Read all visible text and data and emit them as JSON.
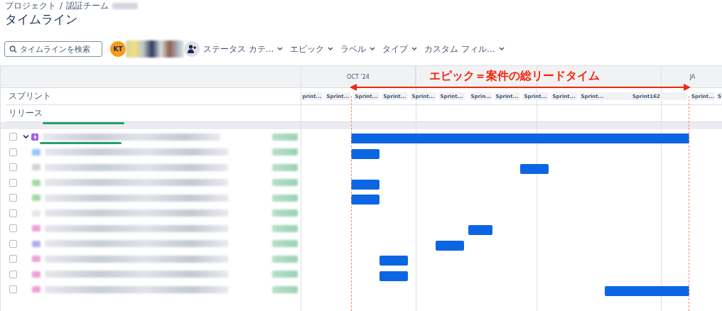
{
  "breadcrumb": {
    "items": [
      "プロジェクト",
      "認証チーム"
    ],
    "separator": "/"
  },
  "title": "タイムライン",
  "search": {
    "placeholder": "タイムラインを検索"
  },
  "avatar": {
    "initials": "KT"
  },
  "filters": [
    {
      "label": "ステータス カテ..."
    },
    {
      "label": "エピック"
    },
    {
      "label": "ラベル"
    },
    {
      "label": "タイプ"
    },
    {
      "label": "カスタム フィル..."
    }
  ],
  "months": [
    {
      "label": "OCT '24"
    },
    {
      "label": "JA"
    }
  ],
  "sprint_row_label": "スプリント",
  "release_row_label": "リリース",
  "sprints": [
    "print...",
    "Sprint...",
    "Sprint...",
    "Sprint...",
    "Sprint...",
    "Sprint...",
    "Sprin...",
    "Sprint...",
    "Sprint...",
    "Sprint...",
    "Sprint...",
    "Sprint162",
    "Sprint...",
    "S"
  ],
  "annotation": {
    "text": "エピック＝案件の総リードタイム"
  },
  "rows": [
    {
      "kind": "epic",
      "expanded": true,
      "checked": false
    },
    {
      "kind": "issue",
      "checked": false
    },
    {
      "kind": "issue",
      "checked": false
    },
    {
      "kind": "issue",
      "checked": false
    },
    {
      "kind": "issue",
      "checked": false
    },
    {
      "kind": "issue",
      "checked": false
    },
    {
      "kind": "issue",
      "checked": false
    },
    {
      "kind": "issue",
      "checked": false
    },
    {
      "kind": "issue",
      "checked": false
    },
    {
      "kind": "issue",
      "checked": false
    },
    {
      "kind": "issue",
      "checked": false
    }
  ]
}
